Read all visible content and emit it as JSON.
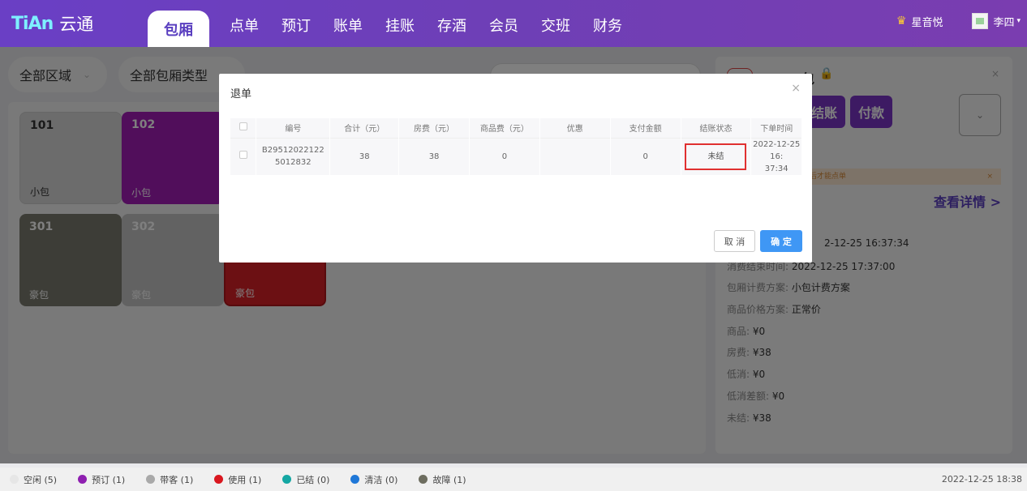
{
  "app": {
    "brand_mark": "TiAn",
    "name": "云通"
  },
  "nav": {
    "active": "包厢",
    "items": [
      "点单",
      "预订",
      "账单",
      "挂账",
      "存酒",
      "会员",
      "交班",
      "财务"
    ]
  },
  "user": {
    "store": "星音悦",
    "name": "李四"
  },
  "filters": {
    "area": "全部区域",
    "room_type": "全部包厢类型"
  },
  "rooms": [
    {
      "num": "101",
      "type": "小包",
      "color": "#d9d9d9"
    },
    {
      "num": "102",
      "type": "小包",
      "color": "#a21db7"
    },
    {
      "num": "301",
      "type": "豪包",
      "color": "#7b7b6f"
    },
    {
      "num": "302",
      "type": "豪包",
      "color": "#c4c4c4"
    },
    {
      "num": "",
      "type": "豪包",
      "color": "#d92026"
    }
  ],
  "right_panel": {
    "room_title": "包",
    "checkout_label": "结账",
    "pay_label": "付款",
    "notice": "后才能点单",
    "detail_link": "查看详情 >",
    "start_time_partial": "2-12-25 16:37:34",
    "end_time_label": "消费结束时间:",
    "end_time": "2022-12-25 17:37:00",
    "plan_label": "包厢计费方案:",
    "plan_value": "小包计费方案",
    "price_label": "商品价格方案:",
    "price_value": "正常价",
    "goods_label": "商品:",
    "goods_value": "¥0",
    "room_fee_label": "房费:",
    "room_fee_value": "¥38",
    "min_label": "低消:",
    "min_value": "¥0",
    "min_diff_label": "低消差额:",
    "min_diff_value": "¥0",
    "unpaid_label": "未结:",
    "unpaid_value": "¥38"
  },
  "dialog": {
    "title": "退单",
    "columns": [
      "编号",
      "合计（元）",
      "房费（元）",
      "商品费（元）",
      "优惠",
      "支付金额",
      "结账状态",
      "下单时间"
    ],
    "rows": [
      {
        "id_line1": "B29512022122",
        "id_line2": "5012832",
        "total": "38",
        "room_fee": "38",
        "goods_fee": "0",
        "discount": "",
        "paid": "0",
        "status": "未结",
        "time_line1": "2022-12-25 16:",
        "time_line2": "37:34"
      }
    ],
    "cancel_label": "取 消",
    "ok_label": "确 定"
  },
  "legend": [
    {
      "label": "空闲 (5)",
      "color": "#e6e6e6"
    },
    {
      "label": "预订 (1)",
      "color": "#8e1fb0"
    },
    {
      "label": "带客 (1)",
      "color": "#a9a9a9"
    },
    {
      "label": "使用 (1)",
      "color": "#d9171f"
    },
    {
      "label": "已结 (0)",
      "color": "#14a7a3"
    },
    {
      "label": "清洁 (0)",
      "color": "#1f78d8"
    },
    {
      "label": "故障 (1)",
      "color": "#6d6d5f"
    }
  ],
  "footer_time": "2022-12-25 18:38"
}
